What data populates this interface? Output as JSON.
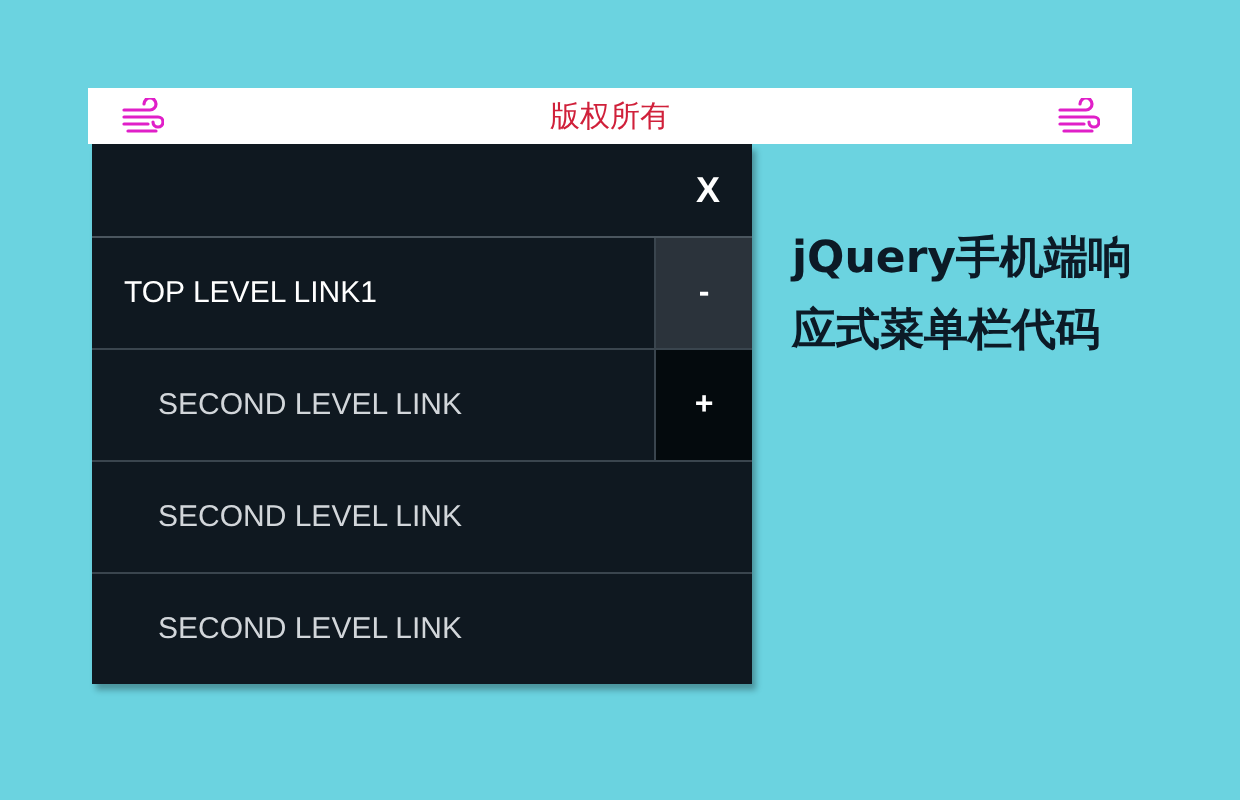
{
  "banner": {
    "text": "版权所有"
  },
  "menu": {
    "close_label": "X",
    "items": [
      {
        "label": "TOP LEVEL LINK1",
        "toggle": "-",
        "expanded": true,
        "children": [
          {
            "label": "SECOND LEVEL LINK",
            "toggle": "+",
            "expanded": false
          },
          {
            "label": "SECOND LEVEL LINK"
          },
          {
            "label": "SECOND LEVEL LINK"
          }
        ]
      }
    ]
  },
  "title": "jQuery手机端响应式菜单栏代码"
}
